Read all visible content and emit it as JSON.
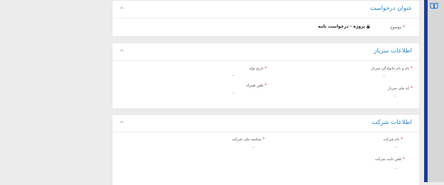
{
  "subject_card": {
    "title": "عنوان درخواست",
    "subject_label": "موضوع",
    "subject_value": "پروژه - درخواست نامه"
  },
  "soldier_card": {
    "title": "اطلاعات سرباز",
    "fields": [
      {
        "label": "نام و نام خانوادگی سرباز",
        "value": "--"
      },
      {
        "label": "تاریخ تولد",
        "value": "--"
      },
      {
        "label": "کد ملی سرباز",
        "value": "--"
      },
      {
        "label": "تلفن همراه",
        "value": "--"
      }
    ]
  },
  "company_card": {
    "title": "اطلاعات شرکت",
    "fields": [
      {
        "label": "نام شرکت",
        "value": "--"
      },
      {
        "label": "شناسه ملی شرکت",
        "value": "--"
      },
      {
        "label": "تلفن ثابت شرکت",
        "value": "--"
      }
    ]
  },
  "icons": {
    "collapse": "chevron-up-icon",
    "sidebar": "book-icon",
    "subject_prefix": "lock-icon"
  },
  "colors": {
    "title_blue": "#2a88c4",
    "required_red": "#e04b4b",
    "sidebar_blue": "#1f3d8a"
  }
}
